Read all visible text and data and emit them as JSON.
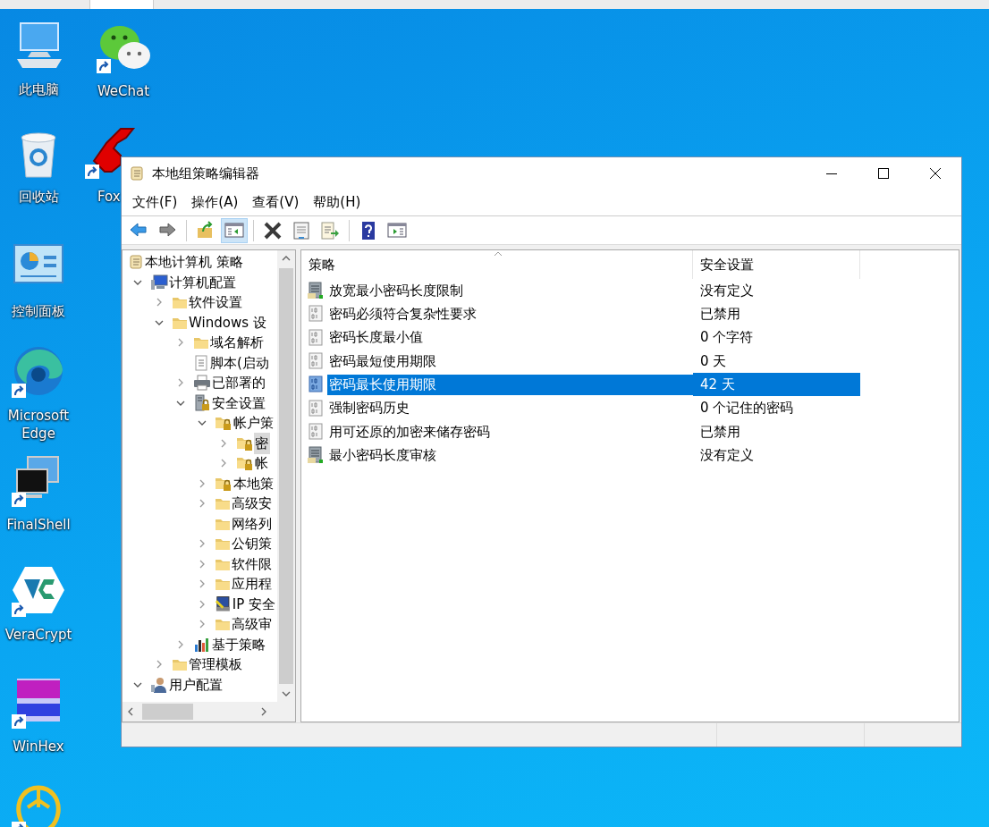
{
  "desktop_icons": [
    {
      "label": "此电脑",
      "kind": "computer",
      "shortcut": false
    },
    {
      "label": "WeChat",
      "kind": "chat",
      "shortcut": true
    },
    {
      "label": "回收站",
      "kind": "recycle",
      "shortcut": false
    },
    {
      "label": "Fox",
      "kind": "red-app",
      "shortcut": true
    },
    {
      "label": "控制面板",
      "kind": "control-panel",
      "shortcut": false
    },
    {
      "label": "Microsoft Edge",
      "kind": "edge",
      "shortcut": true
    },
    {
      "label": "FinalShell",
      "kind": "monitors",
      "shortcut": true
    },
    {
      "label": "VeraCrypt",
      "kind": "hexagon",
      "shortcut": true
    },
    {
      "label": "WinHex",
      "kind": "hex",
      "shortcut": true
    },
    {
      "kind": "ring-app",
      "shortcut": true
    }
  ],
  "window": {
    "title": "本地组策略编辑器",
    "menu": [
      "文件(F)",
      "操作(A)",
      "查看(V)",
      "帮助(H)"
    ],
    "toolbar": [
      {
        "kind": "back",
        "pressed": false
      },
      {
        "kind": "forward",
        "pressed": false
      },
      {
        "kind": "separator"
      },
      {
        "kind": "up",
        "pressed": false
      },
      {
        "kind": "tree-pane",
        "pressed": true
      },
      {
        "kind": "separator"
      },
      {
        "kind": "delete",
        "pressed": false
      },
      {
        "kind": "properties",
        "pressed": false
      },
      {
        "kind": "export",
        "pressed": false
      },
      {
        "kind": "separator"
      },
      {
        "kind": "help",
        "pressed": false
      },
      {
        "kind": "action-pane",
        "pressed": false
      }
    ],
    "tree": [
      {
        "label": "本地计算机 策略",
        "kind": "scroll",
        "selected": false,
        "children": [
          {
            "label": "计算机配置",
            "kind": "computer",
            "expanded": true,
            "selected": false,
            "children": [
              {
                "label": "软件设置",
                "kind": "folder",
                "expanded": false,
                "selected": false
              },
              {
                "label": "Windows 设",
                "kind": "folder",
                "expanded": true,
                "selected": false,
                "children": [
                  {
                    "label": "域名解析",
                    "kind": "folder",
                    "expanded": false,
                    "selected": false
                  },
                  {
                    "label": "脚本(启动",
                    "kind": "script",
                    "selected": false
                  },
                  {
                    "label": "已部署的",
                    "kind": "printer",
                    "expanded": false,
                    "selected": false
                  },
                  {
                    "label": "安全设置",
                    "kind": "server-lock",
                    "expanded": true,
                    "selected": false,
                    "children": [
                      {
                        "label": "帐户策",
                        "kind": "lock-folder",
                        "expanded": true,
                        "selected": false,
                        "children": [
                          {
                            "label": "密",
                            "kind": "lock-folder",
                            "expanded": false,
                            "selected": true
                          },
                          {
                            "label": "帐",
                            "kind": "lock-folder",
                            "expanded": false,
                            "selected": false
                          }
                        ]
                      },
                      {
                        "label": "本地策",
                        "kind": "lock-folder",
                        "expanded": false,
                        "selected": false
                      },
                      {
                        "label": "高级安",
                        "kind": "folder",
                        "expanded": false,
                        "selected": false
                      },
                      {
                        "label": "网络列",
                        "kind": "folder",
                        "selected": false
                      },
                      {
                        "label": "公钥策",
                        "kind": "folder",
                        "expanded": false,
                        "selected": false
                      },
                      {
                        "label": "软件限",
                        "kind": "folder",
                        "expanded": false,
                        "selected": false
                      },
                      {
                        "label": "应用程",
                        "kind": "folder",
                        "expanded": false,
                        "selected": false
                      },
                      {
                        "label": "IP 安全",
                        "kind": "ip-security",
                        "expanded": false,
                        "selected": false
                      },
                      {
                        "label": "高级审",
                        "kind": "folder",
                        "expanded": false,
                        "selected": false
                      }
                    ]
                  },
                  {
                    "label": "基于策略",
                    "kind": "chart",
                    "expanded": false,
                    "selected": false
                  }
                ]
              },
              {
                "label": "管理模板",
                "kind": "folder",
                "expanded": false,
                "selected": false
              }
            ]
          },
          {
            "label": "用户配置",
            "kind": "user",
            "expanded": true,
            "selected": false
          }
        ]
      }
    ],
    "list": {
      "columns": [
        "策略",
        "安全设置"
      ],
      "rows": [
        {
          "kind": "server",
          "policy": "放宽最小密码长度限制",
          "setting": "没有定义",
          "selected": false
        },
        {
          "kind": "binary",
          "policy": "密码必须符合复杂性要求",
          "setting": "已禁用",
          "selected": false
        },
        {
          "kind": "binary",
          "policy": "密码长度最小值",
          "setting": "0 个字符",
          "selected": false
        },
        {
          "kind": "binary",
          "policy": "密码最短使用期限",
          "setting": "0 天",
          "selected": false
        },
        {
          "kind": "binary",
          "policy": "密码最长使用期限",
          "setting": "42 天",
          "selected": true
        },
        {
          "kind": "binary",
          "policy": "强制密码历史",
          "setting": "0 个记住的密码",
          "selected": false
        },
        {
          "kind": "binary",
          "policy": "用可还原的加密来储存密码",
          "setting": "已禁用",
          "selected": false
        },
        {
          "kind": "server",
          "policy": "最小密码长度审核",
          "setting": "没有定义",
          "selected": false
        }
      ]
    }
  }
}
